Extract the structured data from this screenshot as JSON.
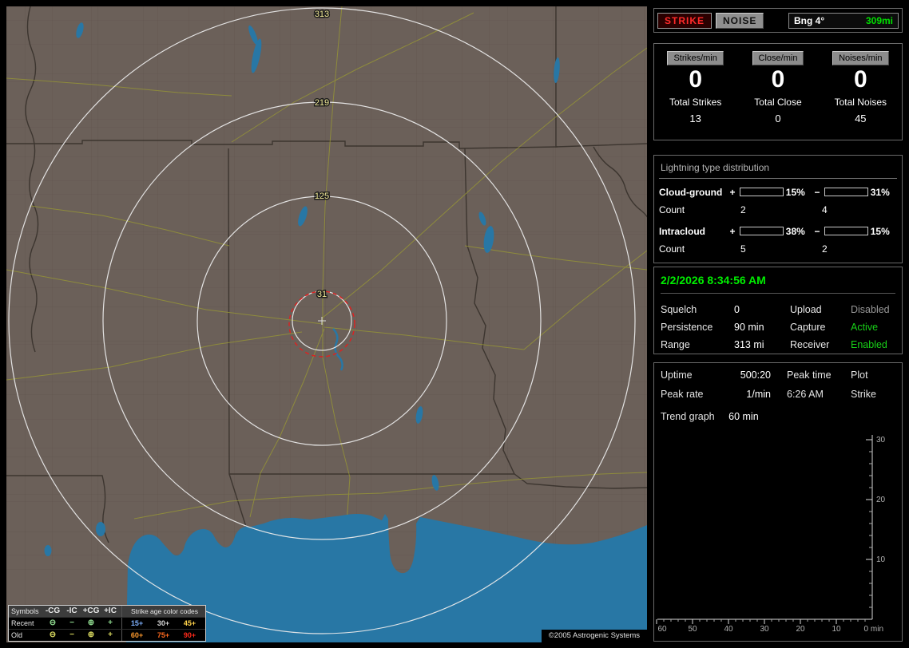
{
  "map": {
    "range_labels": [
      "313",
      "219",
      "125",
      "31"
    ],
    "copyright": "©2005 Astrogenic Systems",
    "legend": {
      "header_label": "Symbols",
      "col_headers": [
        "-CG",
        "-IC",
        "+CG",
        "+IC"
      ],
      "age_title": "Strike age color codes",
      "recent_label": "Recent",
      "old_label": "Old",
      "symbols": [
        "⊖",
        "−",
        "⊕",
        "+"
      ],
      "recent_symbol_style": "color:#8fd98f",
      "old_symbol_style": "color:#d9d95f",
      "recent_ages": [
        {
          "text": "15+",
          "style": "color:#7fb2ff"
        },
        {
          "text": "30+",
          "style": "color:#d8d8d8"
        },
        {
          "text": "45+",
          "style": "color:#ffd24a"
        }
      ],
      "old_ages": [
        {
          "text": "60+",
          "style": "color:#ff9b2e"
        },
        {
          "text": "75+",
          "style": "color:#ff6a1e"
        },
        {
          "text": "90+",
          "style": "color:#ff2a1a"
        }
      ]
    }
  },
  "topbar": {
    "strike_label": "STRIKE",
    "noise_label": "NOISE",
    "bearing_label": "Bng 4°",
    "distance_label": "309mi"
  },
  "stats": {
    "columns": [
      {
        "chip": "Strikes/min",
        "rate": "0",
        "total_label": "Total Strikes",
        "total_value": "13"
      },
      {
        "chip": "Close/min",
        "rate": "0",
        "total_label": "Total Close",
        "total_value": "0"
      },
      {
        "chip": "Noises/min",
        "rate": "0",
        "total_label": "Total Noises",
        "total_value": "45"
      }
    ]
  },
  "distribution": {
    "title": "Lightning type distribution",
    "rows": [
      {
        "label": "Cloud-ground",
        "pos_sign": "+",
        "neg_sign": "−",
        "pos_pct": "15%",
        "neg_pct": "31%",
        "pos_fill_style": "width:15%;background:#ff1a1a",
        "neg_fill_style": "width:31%;background:#7fb2ff",
        "count_label": "Count",
        "pos_count": "2",
        "neg_count": "4"
      },
      {
        "label": "Intracloud",
        "pos_sign": "+",
        "neg_sign": "−",
        "pos_pct": "38%",
        "neg_pct": "15%",
        "pos_fill_style": "width:38%;background:#ff5fd0",
        "neg_fill_style": "width:15%;background:#22dd22",
        "count_label": "Count",
        "pos_count": "5",
        "neg_count": "2"
      }
    ]
  },
  "status": {
    "datetime": "2/2/2026 8:34:56 AM",
    "rows": [
      {
        "l1": "Squelch",
        "v1": "0",
        "l2": "Upload",
        "v2": "Disabled",
        "v2_style": "color:#989898"
      },
      {
        "l1": "Persistence",
        "v1": "90 min",
        "l2": "Capture",
        "v2": "Active",
        "v2_style": "color:#18d018"
      },
      {
        "l1": "Range",
        "v1": "313 mi",
        "l2": "Receiver",
        "v2": "Enabled",
        "v2_style": "color:#18d018"
      }
    ]
  },
  "trend": {
    "info": {
      "r1c1": "Uptime",
      "r1c2": "500:20",
      "r1c3": "Peak time",
      "r1c4": "Plot",
      "r2c1": "Peak rate",
      "r2c2": "1/min",
      "r2c3": "6:26 AM",
      "r2c4": "Strike",
      "graph_label": "Trend graph",
      "graph_window": "60 min"
    },
    "y_ticks": [
      "30",
      "20",
      "10"
    ],
    "x_ticks": [
      "60",
      "50",
      "40",
      "30",
      "20",
      "10"
    ],
    "x_end_label": "0 min"
  }
}
